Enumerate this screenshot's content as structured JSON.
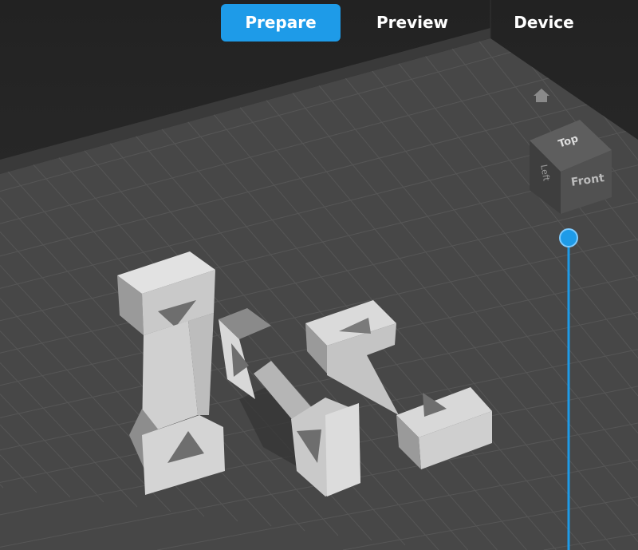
{
  "tabs": [
    {
      "label": "Prepare",
      "active": true
    },
    {
      "label": "Preview",
      "active": false
    },
    {
      "label": "Device",
      "active": false
    }
  ],
  "view_cube": {
    "top": "Top",
    "front": "Front",
    "left": "Left"
  },
  "colors": {
    "accent": "#1e9be8",
    "plate": "#474747",
    "grid": "#565656",
    "model": "#d6d6d6"
  }
}
